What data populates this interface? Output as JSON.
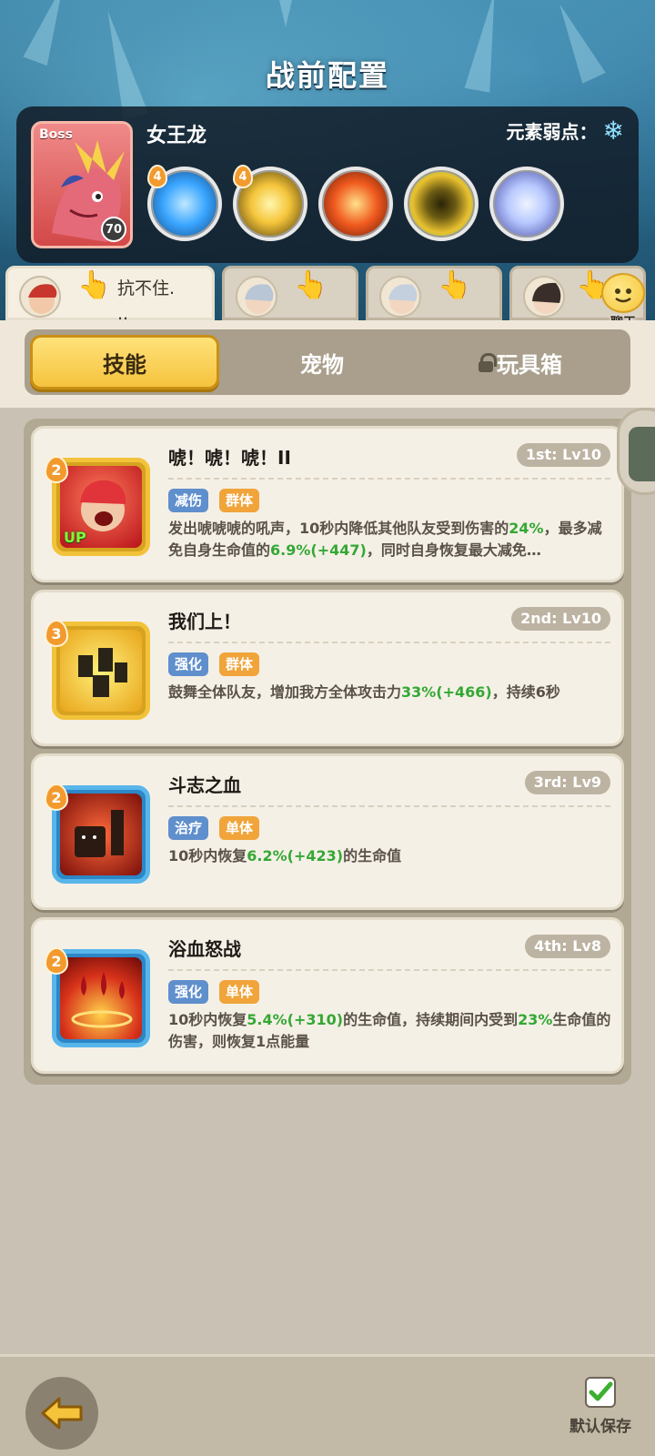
{
  "header": {
    "title": "战前配置"
  },
  "boss": {
    "tag": "Boss",
    "level": "70",
    "name": "女王龙",
    "weakness_label": "元素弱点：",
    "weakness_icon": "snowflake-icon",
    "skills": [
      {
        "icon": "ice-burst-skill-icon",
        "badge": "4",
        "color": "#3aa6ff"
      },
      {
        "icon": "lightning-skill-icon",
        "badge": "4",
        "color": "#f5c53a"
      },
      {
        "icon": "explosion-skill-icon",
        "badge": "",
        "color": "#f05a1e"
      },
      {
        "icon": "golem-skill-icon",
        "badge": "",
        "color": "#e8c030"
      },
      {
        "icon": "crystal-skill-icon",
        "badge": "",
        "color": "#b8c8ff"
      }
    ]
  },
  "party": {
    "members": [
      {
        "avatar": "red-hair-warrior-avatar",
        "status": "抗不住.\n..",
        "active": true
      },
      {
        "avatar": "silver-hair-avatar",
        "status": "",
        "active": false
      },
      {
        "avatar": "silver-hair-avatar-2",
        "status": "",
        "active": false
      },
      {
        "avatar": "dark-hair-avatar",
        "status": "",
        "active": false
      }
    ],
    "chat_label": "聊天"
  },
  "tabs": {
    "skills": "技能",
    "pets": "宠物",
    "toybox": "玩具箱"
  },
  "skills": [
    {
      "name": "唬！唬！唬！II",
      "level": "1st: Lv10",
      "badge": "2",
      "up": "UP",
      "tags": [
        "减伤",
        "群体"
      ],
      "desc_parts": [
        "发出唬唬唬的吼声，10秒内降低其他队友受到伤害的",
        "24%",
        "，最多减免自身生命值的",
        "6.9%(+447)",
        "，同时自身恢复最大减免…"
      ]
    },
    {
      "name": "我们上！",
      "level": "2nd: Lv10",
      "badge": "3",
      "tags": [
        "强化",
        "群体"
      ],
      "desc_parts": [
        "鼓舞全体队友，增加我方全体攻击力",
        "33%(+466)",
        "，持续6秒"
      ]
    },
    {
      "name": "斗志之血",
      "level": "3rd: Lv9",
      "badge": "2",
      "tags": [
        "治疗",
        "单体"
      ],
      "desc_parts": [
        "10秒内恢复",
        "6.2%(+423)",
        "的生命值"
      ]
    },
    {
      "name": "浴血怒战",
      "level": "4th: Lv8",
      "badge": "2",
      "tags": [
        "强化",
        "单体"
      ],
      "desc_parts": [
        "10秒内恢复",
        "5.4%(+310)",
        "的生命值，持续期间内受到",
        "23%",
        "生命值的伤害，则恢复1点能量"
      ]
    }
  ],
  "footer": {
    "back_icon": "back-arrow-icon",
    "save_label": "默认保存",
    "save_checked": true
  }
}
